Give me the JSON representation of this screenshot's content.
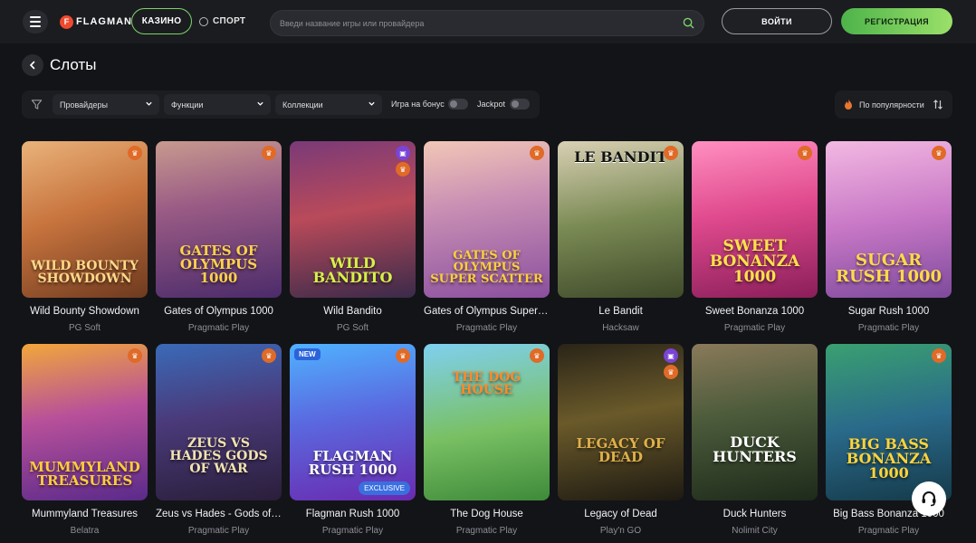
{
  "header": {
    "logo_text": "FLAGMAN",
    "nav": {
      "casino": "КАЗИНО",
      "sport": "СПОРТ"
    },
    "search_placeholder": "Введи название игры или провайдера",
    "login": "ВОЙТИ",
    "register": "РЕГИСТРАЦИЯ"
  },
  "page": {
    "title": "Слоты"
  },
  "filters": {
    "providers": "Провайдеры",
    "features": "Функции",
    "collections": "Коллекции",
    "bonus_play": "Игра на бонус",
    "jackpot": "Jackpot",
    "sort": "По популярности"
  },
  "games": [
    {
      "title": "Wild Bounty Showdown",
      "provider": "PG Soft",
      "art": "WILD BOUNTY SHOWDOWN",
      "badge": "trophy"
    },
    {
      "title": "Gates of Olympus 1000",
      "provider": "Pragmatic Play",
      "art": "GATES OF OLYMPUS 1000",
      "badge": "trophy"
    },
    {
      "title": "Wild Bandito",
      "provider": "PG Soft",
      "art": "WILD BANDITO",
      "badge": "gift+trophy"
    },
    {
      "title": "Gates of Olympus Super Scatter",
      "provider": "Pragmatic Play",
      "art": "GATES OF OLYMPUS SUPER SCATTER",
      "badge": "trophy"
    },
    {
      "title": "Le Bandit",
      "provider": "Hacksaw",
      "art": "LE BANDIT",
      "badge": "trophy"
    },
    {
      "title": "Sweet Bonanza 1000",
      "provider": "Pragmatic Play",
      "art": "SWEET BONANZA 1000",
      "badge": "trophy"
    },
    {
      "title": "Sugar Rush 1000",
      "provider": "Pragmatic Play",
      "art": "SUGAR RUSH 1000",
      "badge": "trophy"
    },
    {
      "title": "Mummyland Treasures",
      "provider": "Belatra",
      "art": "MUMMYLAND TREASURES",
      "badge": "trophy"
    },
    {
      "title": "Zeus vs Hades - Gods of War",
      "provider": "Pragmatic Play",
      "art": "ZEUS VS HADES GODS OF WAR",
      "badge": "trophy"
    },
    {
      "title": "Flagman Rush 1000",
      "provider": "Pragmatic Play",
      "art": "FLAGMAN RUSH 1000",
      "badge": "trophy",
      "tag": "NEW",
      "exclusive": "EXCLUSIVE"
    },
    {
      "title": "The Dog House",
      "provider": "Pragmatic Play",
      "art": "THE DOG HOUSE",
      "badge": "trophy"
    },
    {
      "title": "Legacy of Dead",
      "provider": "Play'n GO",
      "art": "LEGACY OF DEAD",
      "badge": "gift+trophy"
    },
    {
      "title": "Duck Hunters",
      "provider": "Nolimit City",
      "art": "DUCK HUNTERS",
      "badge": "none"
    },
    {
      "title": "Big Bass Bonanza 1000",
      "provider": "Pragmatic Play",
      "art": "BIG BASS BONANZA 1000",
      "badge": "trophy"
    }
  ],
  "icons": {
    "menu": "menu-icon",
    "search": "search-icon",
    "back": "back-arrow-icon",
    "filter": "filter-icon",
    "chevron": "chevron-down-icon",
    "flame": "flame-icon",
    "sort": "sort-arrows-icon",
    "trophy": "trophy-icon",
    "gift": "gift-icon",
    "support": "headset-icon"
  },
  "colors": {
    "accent_green": "#7bd46a",
    "register_gradient_start": "#4db34a",
    "register_gradient_end": "#9be06a",
    "badge_orange": "#e06a27",
    "badge_purple": "#7a44d6",
    "background": "#131418"
  }
}
